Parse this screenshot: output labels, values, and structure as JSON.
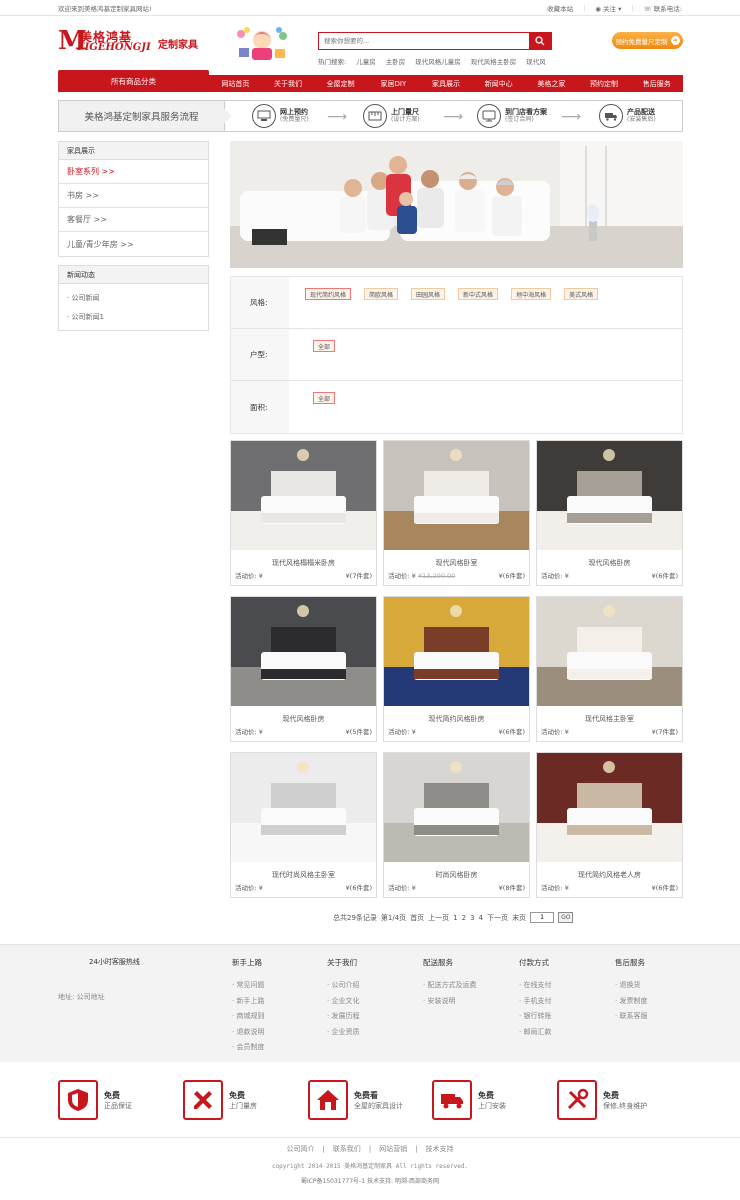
{
  "topbar": {
    "welcome": "欢迎来到美格鸿基定制家具网站!",
    "bookmark": "收藏本站",
    "follow": "关注",
    "contact": "联系电话:"
  },
  "header": {
    "logo_m": "M",
    "logo_cn": "美格鸿基",
    "logo_en": "EIGEHONGJI",
    "logo_tag": "定制家具",
    "search_placeholder": "搜索你想要的...",
    "hot_label": "热门搜索:",
    "hot_items": [
      "儿童房",
      "主卧房",
      "现代风格儿童房",
      "现代风格主卧房",
      "现代风"
    ],
    "reserve_button": "预约免费量尺定制"
  },
  "nav": {
    "all_categories": "所有商品分类",
    "items": [
      "网站首页",
      "关于我们",
      "全屋定制",
      "家居DIY",
      "家具展示",
      "新闻中心",
      "美格之家",
      "预约定制",
      "售后服务"
    ]
  },
  "process": {
    "title": "美格鸿基定制家具服务流程",
    "steps": [
      {
        "t1": "网上预约",
        "t2": "(免费量尺)"
      },
      {
        "t1": "上门量尺",
        "t2": "(设计方案)"
      },
      {
        "t1": "到门店看方案",
        "t2": "(签订合同)"
      },
      {
        "t1": "产品配送",
        "t2": "(安装售后)"
      }
    ]
  },
  "sidebar": {
    "furniture_title": "家具展示",
    "furniture_items": [
      "卧室系列 >>",
      "书房 >>",
      "客餐厅 >>",
      "儿童/青少年房 >>"
    ],
    "news_title": "新闻动态",
    "news_items": [
      "· 公司新闻",
      "· 公司新闻1"
    ]
  },
  "filter": {
    "style_label": "风格:",
    "style_options": [
      "现代简约风格",
      "简欧风格",
      "田园风格",
      "新中式风格",
      "地中海风格",
      "美式风格"
    ],
    "layout_label": "户型:",
    "layout_options": [
      "全部"
    ],
    "area_label": "面积:",
    "area_options": [
      "全部"
    ]
  },
  "products": [
    {
      "name": "现代风格榻榻米卧房",
      "price_label": "活动价:",
      "price": "¥",
      "orig": "",
      "sales_prefix": "¥",
      "sales": "(7件套)"
    },
    {
      "name": "现代风格卧室",
      "price_label": "活动价:",
      "price": "¥",
      "orig": "¥13,200.00",
      "sales_prefix": "¥",
      "sales": "(6件套)"
    },
    {
      "name": "现代风格卧房",
      "price_label": "活动价:",
      "price": "¥",
      "orig": "",
      "sales_prefix": "¥",
      "sales": "(6件套)"
    },
    {
      "name": "现代风格卧房",
      "price_label": "活动价:",
      "price": "¥",
      "orig": "",
      "sales_prefix": "¥",
      "sales": "(5件套)"
    },
    {
      "name": "现代简约风格卧房",
      "price_label": "活动价:",
      "price": "¥",
      "orig": "",
      "sales_prefix": "¥",
      "sales": "(6件套)"
    },
    {
      "name": "现代风格主卧室",
      "price_label": "活动价:",
      "price": "¥",
      "orig": "",
      "sales_prefix": "¥",
      "sales": "(7件套)"
    },
    {
      "name": "现代时尚风格主卧室",
      "price_label": "活动价:",
      "price": "¥",
      "orig": "",
      "sales_prefix": "¥",
      "sales": "(6件套)"
    },
    {
      "name": "时尚风格卧房",
      "price_label": "活动价:",
      "price": "¥",
      "orig": "",
      "sales_prefix": "¥",
      "sales": "(8件套)"
    },
    {
      "name": "现代简约风格老人房",
      "price_label": "活动价:",
      "price": "¥",
      "orig": "",
      "sales_prefix": "¥",
      "sales": "(6件套)"
    }
  ],
  "pager": {
    "total": "总共29条记录",
    "page": "第1/4页",
    "first": "首页",
    "prev": "上一页",
    "pages": [
      "1",
      "2",
      "3",
      "4"
    ],
    "next": "下一页",
    "last": "末页",
    "input_value": "1",
    "go": "GO"
  },
  "footer": {
    "hotline": "24小时客服热线",
    "address": "地址: 公司地址",
    "columns": [
      {
        "title": "新手上路",
        "items": [
          "· 常见问题",
          "· 新手上路",
          "· 商城规则",
          "· 退款说明",
          "· 会员制度"
        ]
      },
      {
        "title": "关于我们",
        "items": [
          "· 公司介绍",
          "· 企业文化",
          "· 发展历程",
          "· 企业资质"
        ]
      },
      {
        "title": "配送服务",
        "items": [
          "· 配送方式及运费",
          "· 安装说明"
        ]
      },
      {
        "title": "付款方式",
        "items": [
          "· 在线支付",
          "· 手机支付",
          "· 银行转账",
          "· 邮局汇款"
        ]
      },
      {
        "title": "售后服务",
        "items": [
          "· 退换货",
          "· 发票制度",
          "· 联系客服"
        ]
      }
    ]
  },
  "guarantees": [
    {
      "icon": "shield-icon",
      "t1": "免费",
      "t2": "正品保证"
    },
    {
      "icon": "ruler-pencil-icon",
      "t1": "免费",
      "t2": "上门量房"
    },
    {
      "icon": "house-icon",
      "t1": "免费看",
      "t2": "全屋的家具设计"
    },
    {
      "icon": "truck-icon",
      "t1": "免费",
      "t2": "上门安装"
    },
    {
      "icon": "tools-icon",
      "t1": "免费",
      "t2": "保修,终身维护"
    }
  ],
  "bottom": {
    "links": [
      "公司简介",
      "|",
      "联系我们",
      "|",
      "网站营销",
      "|",
      "技术支持"
    ],
    "copyright": "copyright 2014-2015 美格鸿基定制家具 All rights reserved.",
    "icp": "蜀ICP备15031777号-1 技术支持: 明溯-西部商务网"
  },
  "colors": {
    "brand_red": "#c8161d",
    "orange": "#f08a0d"
  }
}
